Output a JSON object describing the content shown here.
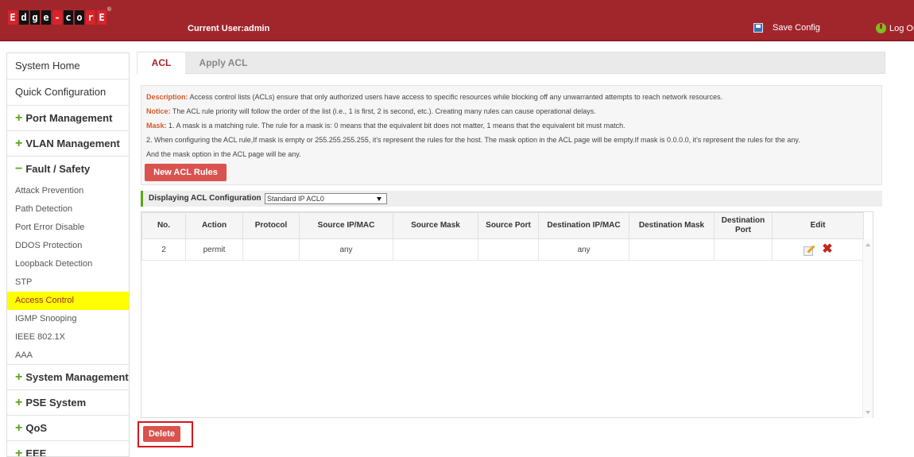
{
  "header": {
    "logo_letters": [
      "E",
      "d",
      "g",
      "e",
      "-",
      "c",
      "o",
      "r",
      "E"
    ],
    "current_user": "Current User:admin",
    "save_config": "Save Config",
    "logout": "Log Ou"
  },
  "sidebar": {
    "system_home": "System Home",
    "quick_configuration": "Quick Configuration",
    "port_management": "Port Management",
    "vlan_management": "VLAN Management",
    "fault_safety": "Fault / Safety",
    "sub_items": [
      "Attack Prevention",
      "Path Detection",
      "Port Error Disable",
      "DDOS Protection",
      "Loopback Detection",
      "STP",
      "Access Control",
      "IGMP Snooping",
      "IEEE 802.1X",
      "AAA"
    ],
    "system_management": "System Management",
    "pse_system": "PSE System",
    "qos": "QoS",
    "eee": "EEE",
    "plus": "+",
    "minus": "−"
  },
  "tabs": {
    "acl": "ACL",
    "apply_acl": "Apply ACL"
  },
  "description": {
    "desc_label": "Description:",
    "desc_text": " Access control lists (ACLs) ensure that only authorized users have access to specific resources while blocking off any unwarranted attempts to reach network resources.",
    "notice_label": "Notice:",
    "notice_text": " The ACL rule priority will follow the order of the list (i.e., 1 is first, 2 is second, etc.). Creating many rules can cause operational delays.",
    "mask_label": "Mask:",
    "mask_text": " 1. A mask is a matching rule. The rule for a mask is: 0 means that the equivalent bit does not matter, 1 means that the equivalent bit must match.",
    "line4": "2. When configuring the ACL rule,If mask is empty or 255.255.255.255, it's represent the rules for the host. The mask option in the ACL page will be empty.If mask is 0.0.0.0, it's represent the rules for the any.",
    "line5": "And the mask option in the ACL page will be any.",
    "new_acl_button": "New ACL Rules"
  },
  "display": {
    "label": "Displaying ACL Configuration",
    "selected": "Standard IP ACL0"
  },
  "table": {
    "headers": [
      "No.",
      "Action",
      "Protocol",
      "Source IP/MAC",
      "Source Mask",
      "Source Port",
      "Destination IP/MAC",
      "Destination Mask",
      "Destination Port",
      "Edit"
    ],
    "rows": [
      [
        "2",
        "permit",
        "",
        "any",
        "",
        "",
        "any",
        "",
        "",
        ""
      ]
    ]
  },
  "delete_button": "Delete"
}
